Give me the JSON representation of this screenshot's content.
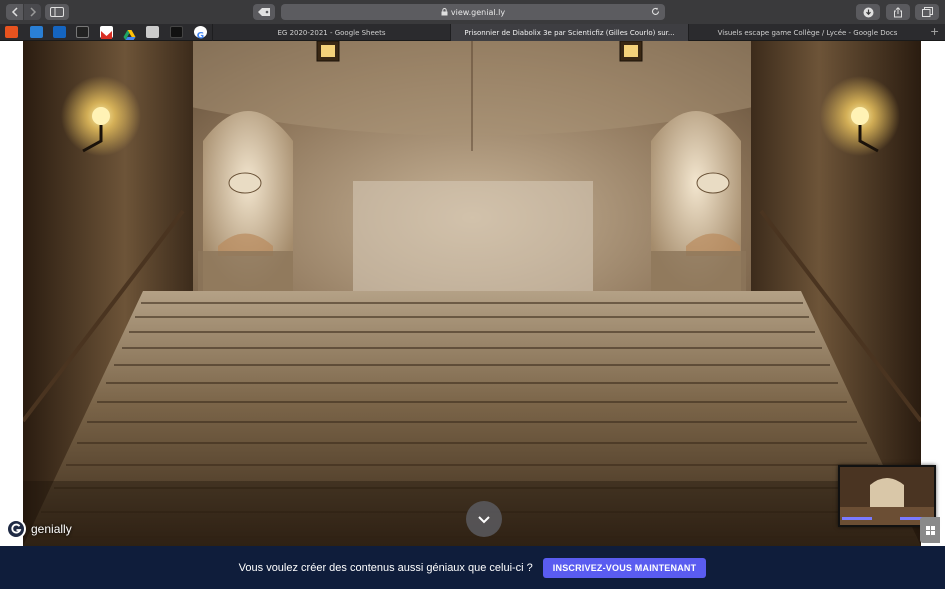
{
  "browser": {
    "url": "view.genial.ly",
    "tabs": [
      {
        "label": "EG 2020-2021 - Google Sheets",
        "active": false
      },
      {
        "label": "Prisonnier de Diabolix 3e par Scienticfiz (Gilles Courlo) sur...",
        "active": true
      },
      {
        "label": "Visuels escape game Collège / Lycée - Google Docs",
        "active": false
      }
    ],
    "bookmarks": [
      {
        "icon": "bookmark-orange-icon",
        "color": "#e8531f"
      },
      {
        "icon": "bookmark-blue-icon",
        "color": "#2a7fd4"
      },
      {
        "icon": "bookmark-outlook-icon",
        "color": "#1565c0"
      },
      {
        "icon": "bookmark-fx-icon",
        "color": "#222222"
      },
      {
        "icon": "bookmark-gmail-icon",
        "color": "#d93025"
      },
      {
        "icon": "bookmark-drive-icon",
        "color": "#1fa463"
      },
      {
        "icon": "bookmark-grey-icon",
        "color": "#cccccc"
      },
      {
        "icon": "bookmark-dark-icon",
        "color": "#111111"
      },
      {
        "icon": "bookmark-google-icon",
        "color": "#ffffff"
      }
    ]
  },
  "page": {
    "brand": "genially",
    "banner_text": "Vous voulez créer des contenus aussi géniaux que celui-ci ?",
    "cta_label": "INSCRIVEZ-VOUS MAINTENANT"
  },
  "colors": {
    "banner_bg": "#0f1d3b",
    "cta_bg": "#5a5cf0"
  }
}
